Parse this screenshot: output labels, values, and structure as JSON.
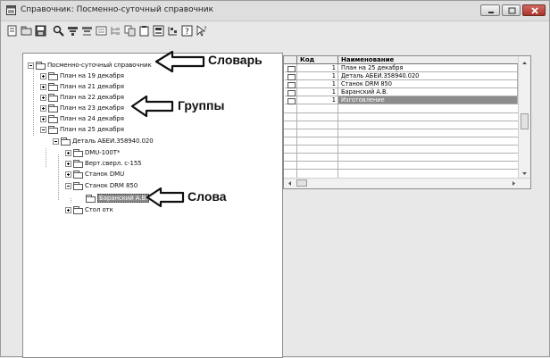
{
  "window": {
    "title": "Справочник: Посменно-суточный справочник"
  },
  "toolbar": {
    "buttons": [
      "new-icon",
      "open-icon",
      "save-icon",
      "find-icon",
      "filter-icon",
      "filter2-icon",
      "properties-icon",
      "tree-icon",
      "copy-icon",
      "paste-icon",
      "import-icon",
      "export-icon",
      "help-icon",
      "context-help-icon"
    ]
  },
  "tree": {
    "root": "Посменно-суточный справочник",
    "items": [
      "План на 19 декабря",
      "План на 21 декабря",
      "План на 22 декабря",
      "План на 23 декабря",
      "План на 24 декабря",
      "План на 25 декабря",
      "Деталь АБЕИ.358940.020",
      "DMU-100T*",
      "Верт.сверл. с-155",
      "Станок DMU",
      "Станок DRM 850",
      "Баранский А.В.",
      "Стол отк"
    ]
  },
  "annotations": {
    "dictionary": "Словарь",
    "groups": "Группы",
    "words": "Слова"
  },
  "grid": {
    "columns": [
      "Код",
      "Наименование"
    ],
    "rows": [
      {
        "code": "1",
        "name": "План на 25 декабря"
      },
      {
        "code": "1",
        "name": "Деталь АБЕИ.358940.020"
      },
      {
        "code": "1",
        "name": "Станок DRM 850"
      },
      {
        "code": "1",
        "name": "Баранский А.В."
      },
      {
        "code": "1",
        "name": "Изготовление"
      }
    ]
  }
}
